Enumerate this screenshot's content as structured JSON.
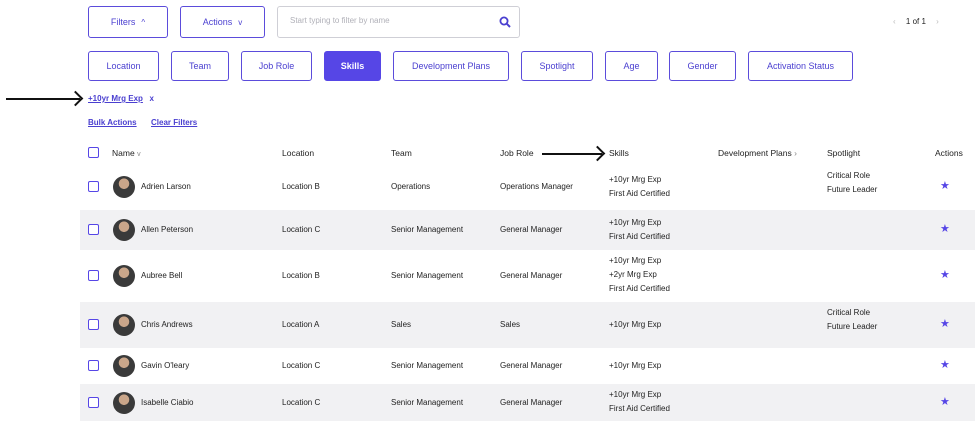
{
  "toolbar": {
    "filters_label": "Filters",
    "actions_label": "Actions",
    "search_placeholder": "Start typing to filter by name",
    "pagination": "1 of 1"
  },
  "filter_tabs": [
    {
      "label": "Location",
      "active": false
    },
    {
      "label": "Team",
      "active": false
    },
    {
      "label": "Job Role",
      "active": false
    },
    {
      "label": "Skills",
      "active": true
    },
    {
      "label": "Development Plans",
      "active": false
    },
    {
      "label": "Spotlight",
      "active": false
    },
    {
      "label": "Age",
      "active": false
    },
    {
      "label": "Gender",
      "active": false
    },
    {
      "label": "Activation Status",
      "active": false
    }
  ],
  "active_filter": {
    "label": "+10yr Mrg Exp",
    "remove": "x"
  },
  "actions": {
    "bulk": "Bulk Actions",
    "clear": "Clear Filters"
  },
  "columns": {
    "name": "Name",
    "location": "Location",
    "team": "Team",
    "job_role": "Job Role",
    "skills": "Skills",
    "development_plans": "Development Plans",
    "spotlight": "Spotlight",
    "actions": "Actions"
  },
  "rows": [
    {
      "name": "Adrien Larson",
      "location": "Location B",
      "team": "Operations",
      "job_role": "Operations Manager",
      "skills": [
        "+10yr Mrg Exp",
        "First Aid Certified"
      ],
      "spotlight": [
        "Critical Role",
        "Future Leader"
      ]
    },
    {
      "name": "Allen Peterson",
      "location": "Location C",
      "team": "Senior Management",
      "job_role": "General Manager",
      "skills": [
        "+10yr Mrg Exp",
        "First Aid Certified"
      ],
      "spotlight": []
    },
    {
      "name": "Aubree Bell",
      "location": "Location B",
      "team": "Senior Management",
      "job_role": "General Manager",
      "skills": [
        "+10yr Mrg Exp",
        "+2yr Mrg Exp",
        "First Aid Certified"
      ],
      "spotlight": []
    },
    {
      "name": "Chris Andrews",
      "location": "Location A",
      "team": "Sales",
      "job_role": "Sales",
      "skills": [
        "+10yr Mrg Exp"
      ],
      "spotlight": [
        "Critical Role",
        "Future Leader"
      ]
    },
    {
      "name": "Gavin O'leary",
      "location": "Location C",
      "team": "Senior Management",
      "job_role": "General Manager",
      "skills": [
        "+10yr Mrg Exp"
      ],
      "spotlight": []
    },
    {
      "name": "Isabelle Ciabio",
      "location": "Location C",
      "team": "Senior Management",
      "job_role": "General Manager",
      "skills": [
        "+10yr Mrg Exp",
        "First Aid Certified"
      ],
      "spotlight": []
    }
  ],
  "icons": {
    "search": "search-icon",
    "star": "star-icon",
    "chevron": "chevron-icon",
    "sort": "sort-icon"
  },
  "colors": {
    "accent": "#5646e6",
    "row_alt": "#f1f1f3"
  }
}
